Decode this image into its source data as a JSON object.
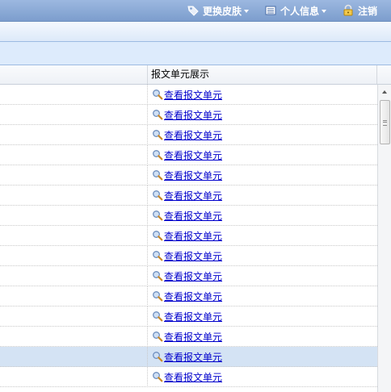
{
  "topbar": {
    "skin_label": "更换皮肤",
    "profile_label": "个人信息",
    "logout_label": "注销"
  },
  "grid": {
    "column_header": "报文单元展示",
    "rows": [
      {
        "link": "查看报文单元",
        "selected": false
      },
      {
        "link": "查看报文单元",
        "selected": false
      },
      {
        "link": "查看报文单元",
        "selected": false
      },
      {
        "link": "查看报文单元",
        "selected": false
      },
      {
        "link": "查看报文单元",
        "selected": false
      },
      {
        "link": "查看报文单元",
        "selected": false
      },
      {
        "link": "查看报文单元",
        "selected": false
      },
      {
        "link": "查看报文单元",
        "selected": false
      },
      {
        "link": "查看报文单元",
        "selected": false
      },
      {
        "link": "查看报文单元",
        "selected": false
      },
      {
        "link": "查看报文单元",
        "selected": false
      },
      {
        "link": "查看报文单元",
        "selected": false
      },
      {
        "link": "查看报文单元",
        "selected": false
      },
      {
        "link": "查看报文单元",
        "selected": true
      },
      {
        "link": "查看报文单元",
        "selected": false
      }
    ]
  },
  "colors": {
    "link": "#0000cc",
    "selected_row": "#d4e3f4",
    "topbar": "#7c9dcd"
  },
  "icons": {
    "skin": "tag-icon",
    "profile": "card-icon",
    "logout": "lock-icon",
    "row_link": "magnifier-icon"
  }
}
